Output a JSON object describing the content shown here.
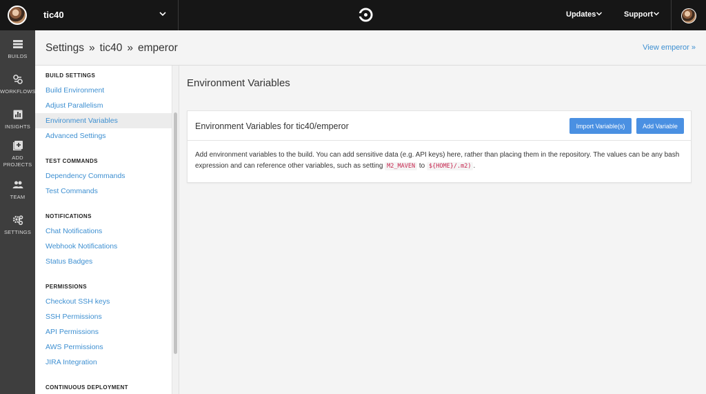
{
  "topbar": {
    "org_name": "tic40",
    "updates_label": "Updates",
    "support_label": "Support"
  },
  "rail": {
    "items": [
      {
        "label": "BUILDS",
        "icon": "builds-icon"
      },
      {
        "label": "WORKFLOWS",
        "icon": "workflows-icon"
      },
      {
        "label": "INSIGHTS",
        "icon": "insights-icon"
      },
      {
        "label_line1": "ADD",
        "label_line2": "PROJECTS",
        "icon": "add-projects-icon"
      },
      {
        "label": "TEAM",
        "icon": "team-icon"
      },
      {
        "label": "SETTINGS",
        "icon": "settings-icon"
      }
    ]
  },
  "header": {
    "breadcrumb": [
      "Settings",
      "tic40",
      "emperor"
    ],
    "separator": "»",
    "view_link": "View emperor »"
  },
  "settings_nav": {
    "build_settings": {
      "heading": "BUILD SETTINGS",
      "items": [
        "Build Environment",
        "Adjust Parallelism",
        "Environment Variables",
        "Advanced Settings"
      ]
    },
    "test_commands": {
      "heading": "TEST COMMANDS",
      "items": [
        "Dependency Commands",
        "Test Commands"
      ]
    },
    "notifications": {
      "heading": "NOTIFICATIONS",
      "items": [
        "Chat Notifications",
        "Webhook Notifications",
        "Status Badges"
      ]
    },
    "permissions": {
      "heading": "PERMISSIONS",
      "items": [
        "Checkout SSH keys",
        "SSH Permissions",
        "API Permissions",
        "AWS Permissions",
        "JIRA Integration"
      ]
    },
    "continuous_deployment": {
      "heading": "CONTINUOUS DEPLOYMENT"
    },
    "active_item": "Environment Variables"
  },
  "main": {
    "title": "Environment Variables",
    "card": {
      "title": "Environment Variables for tic40/emperor",
      "import_button": "Import Variable(s)",
      "add_button": "Add Variable",
      "body_text_1": "Add environment variables to the build. You can add sensitive data (e.g. API keys) here, rather than placing them in the repository. The values can be any bash expression and can reference other variables, such as setting",
      "code_1": "M2_MAVEN",
      "body_text_2": "to",
      "code_2": "${HOME}/.m2)",
      "body_text_3": "."
    }
  },
  "colors": {
    "topbar_bg": "#161616",
    "rail_bg": "#3e3e3e",
    "link": "#3d8fd1",
    "button": "#4a90e2",
    "code": "#c7254e"
  }
}
